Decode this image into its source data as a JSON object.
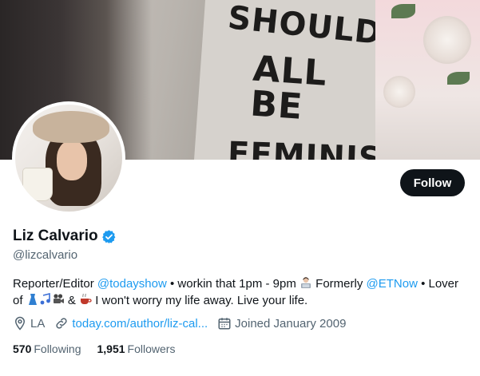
{
  "banner": {
    "shirt_lines": [
      "SHOULD",
      "ALL BE",
      "FEMINISTS"
    ]
  },
  "profile": {
    "display_name": "Liz Calvario",
    "handle": "@lizcalvario",
    "follow_label": "Follow",
    "verified_icon": "verified-badge-icon",
    "accent_color": "#1d9bf0"
  },
  "bio": {
    "part1": "Reporter/Editor ",
    "mention1": "@todayshow",
    "part2": " • workin that 1pm - 9pm ",
    "part3": " Formerly ",
    "mention2": "@ETNow",
    "part4": " • Lover of ",
    "part5": " & ",
    "part6": " I won't worry my life away. Live your life."
  },
  "meta": {
    "location": "LA",
    "website": "today.com/author/liz-cal...",
    "joined": "Joined January 2009"
  },
  "stats": {
    "following_count": "570",
    "following_label": "Following",
    "followers_count": "1,951",
    "followers_label": "Followers"
  }
}
